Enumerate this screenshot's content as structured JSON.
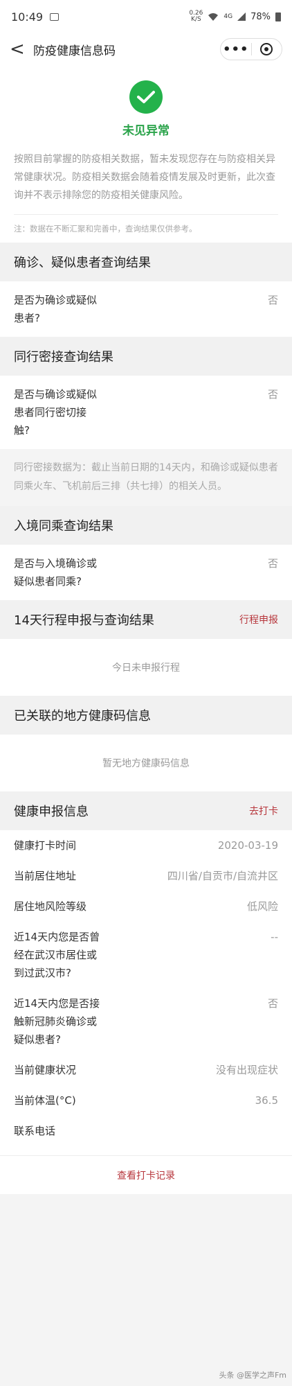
{
  "statusbar": {
    "time": "10:49",
    "net_top": "0.26",
    "net_bottom": "K/S",
    "signal": "4G",
    "battery": "78%"
  },
  "nav": {
    "back": "<",
    "title": "防疫健康信息码",
    "more": "•••"
  },
  "status": {
    "title": "未见异常",
    "description": "按照目前掌握的防疫相关数据，暂未发现您存在与防疫相关异常健康状况。防疫相关数据会随着疫情发展及时更新，此次查询并不表示排除您的防疫相关健康风险。",
    "note": "注：数据在不断汇聚和完善中，查询结果仅供参考。"
  },
  "sec1": {
    "title": "确诊、疑似患者查询结果",
    "question": "是否为确诊或疑似患者?",
    "answer": "否"
  },
  "sec2": {
    "title": "同行密接查询结果",
    "question": "是否与确诊或疑似患者同行密切接触?",
    "answer": "否",
    "info": "同行密接数据为：截止当前日期的14天内，和确诊或疑似患者同乘火车、飞机前后三排（共七排）的相关人员。"
  },
  "sec3": {
    "title": "入境同乘查询结果",
    "question": "是否与入境确诊或疑似患者同乘?",
    "answer": "否"
  },
  "sec4": {
    "title": "14天行程申报与查询结果",
    "link": "行程申报",
    "empty": "今日未申报行程"
  },
  "sec5": {
    "title": "已关联的地方健康码信息",
    "empty": "暂无地方健康码信息"
  },
  "sec6": {
    "title": "健康申报信息",
    "link": "去打卡",
    "rows": [
      {
        "label": "健康打卡时间",
        "value": "2020-03-19"
      },
      {
        "label": "当前居住地址",
        "value": "四川省/自贡市/自流井区"
      },
      {
        "label": "居住地风险等级",
        "value": "低风险"
      },
      {
        "label": "近14天内您是否曾经在武汉市居住或到过武汉市?",
        "value": "--"
      },
      {
        "label": "近14天内您是否接触新冠肺炎确诊或疑似患者?",
        "value": "否"
      },
      {
        "label": "当前健康状况",
        "value": "没有出现症状"
      },
      {
        "label": "当前体温(°C)",
        "value": "36.5"
      },
      {
        "label": "联系电话",
        "value": ""
      }
    ]
  },
  "footer": {
    "link": "查看打卡记录"
  },
  "watermark": "头条 @医学之声Fm"
}
